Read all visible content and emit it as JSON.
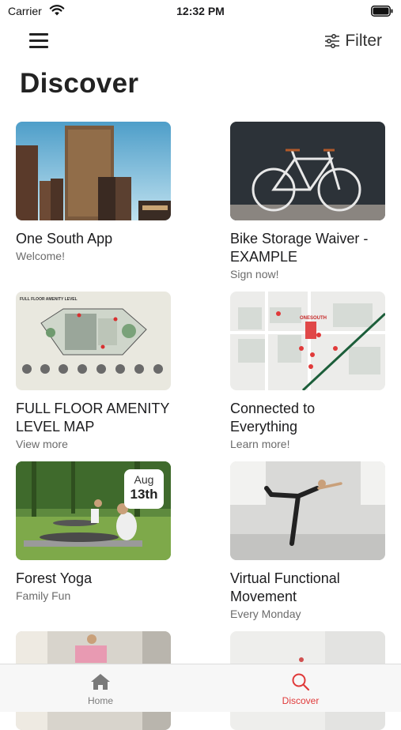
{
  "status_bar": {
    "carrier": "Carrier",
    "time": "12:32 PM"
  },
  "header": {
    "filter_label": "Filter",
    "title": "Discover"
  },
  "cards": [
    {
      "title": "One South App",
      "subtitle": "Welcome!"
    },
    {
      "title": "Bike Storage Waiver - EXAMPLE",
      "subtitle": "Sign now!"
    },
    {
      "title": "FULL FLOOR AMENITY LEVEL MAP",
      "subtitle": "View more",
      "image_text": {
        "heading": "FULL FLOOR AMENITY LEVEL"
      }
    },
    {
      "title": "Connected to Everything",
      "subtitle": "Learn more!",
      "image_text": {
        "map_label": "ONESOUTH"
      }
    },
    {
      "title": "Forest Yoga",
      "subtitle": "Family Fun",
      "date": {
        "month": "Aug",
        "day": "13th"
      }
    },
    {
      "title": "Virtual Functional Movement",
      "subtitle": "Every Monday"
    }
  ],
  "tab_bar": {
    "tabs": [
      {
        "label": "Home",
        "icon": "home-icon",
        "active": false
      },
      {
        "label": "Discover",
        "icon": "search-icon",
        "active": true
      }
    ]
  },
  "colors": {
    "accent": "#e03a3a",
    "inactive_tab": "#7a7a7a",
    "subtitle": "#6b6b6b"
  }
}
